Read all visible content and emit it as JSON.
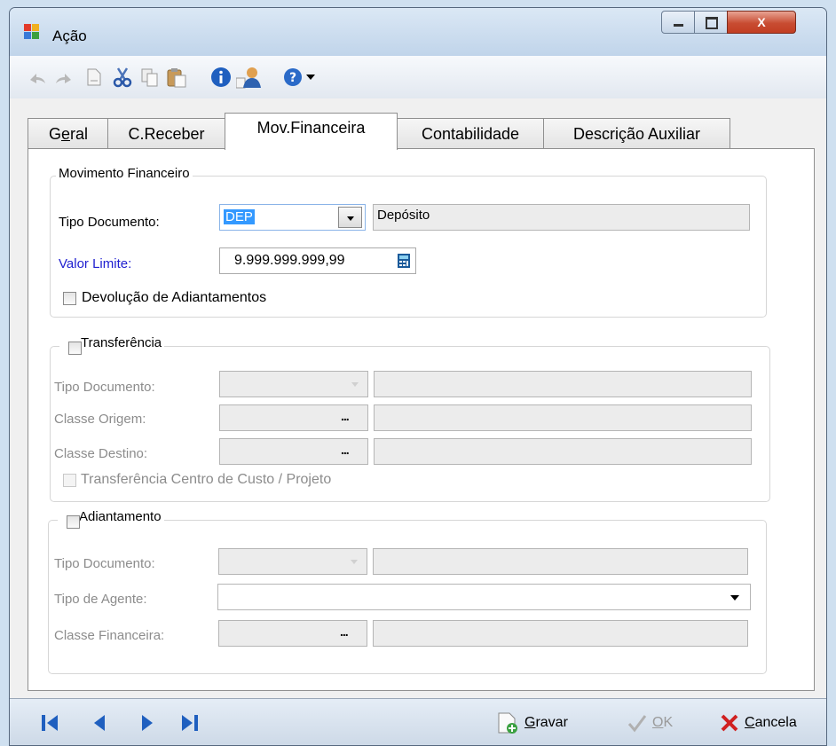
{
  "window": {
    "title": "Ação",
    "close_glyph": "X",
    "icons": {
      "app": "app-icon",
      "minimize": "minimize-icon",
      "maximize": "maximize-icon",
      "close": "close-icon"
    }
  },
  "toolbar": {
    "icons": [
      "undo-icon",
      "redo-icon",
      "new-document-icon",
      "cut-icon",
      "copy-icon",
      "paste-icon",
      "info-icon",
      "user-icon",
      "help-icon",
      "dropdown-arrow-icon"
    ]
  },
  "tabs": [
    {
      "label_pre": "G",
      "label_ul": "e",
      "label_post": "ral",
      "active": false
    },
    {
      "label": "C.Receber",
      "active": false
    },
    {
      "label": "Mov.Financeira",
      "active": true
    },
    {
      "label": "Contabilidade",
      "active": false
    },
    {
      "label": "Descrição Auxiliar",
      "active": false
    }
  ],
  "movimento": {
    "title": "Movimento Financeiro",
    "tipo_label": "Tipo Documento:",
    "tipo_value": "DEP",
    "tipo_desc": "Depósito",
    "valor_label": "Valor Limite:",
    "valor_value": "9.999.999.999,99",
    "devolucao_label": "Devolução de Adiantamentos",
    "devolucao_checked": false
  },
  "transferencia": {
    "title": "Transferência",
    "checked": false,
    "tipo_label": "Tipo Documento:",
    "origem_label": "Classe Origem:",
    "destino_label": "Classe Destino:",
    "ellipsis": "...",
    "centro_label": "Transferência Centro de Custo / Projeto"
  },
  "adiantamento": {
    "title": "Adiantamento",
    "checked": false,
    "tipo_label": "Tipo Documento:",
    "agente_label": "Tipo de Agente:",
    "classe_label": "Classe Financeira:",
    "ellipsis": "..."
  },
  "footer": {
    "nav_icons": [
      "first-record-icon",
      "previous-record-icon",
      "next-record-icon",
      "last-record-icon"
    ],
    "gravar_ul": "G",
    "gravar_rest": "ravar",
    "ok_ul": "O",
    "ok_rest": "K",
    "cancela_ul": "C",
    "cancela_rest": "ancela"
  },
  "colors": {
    "accent_blue": "#2020d0",
    "nav_blue": "#1f5fbf",
    "cancel_red": "#d02020"
  }
}
